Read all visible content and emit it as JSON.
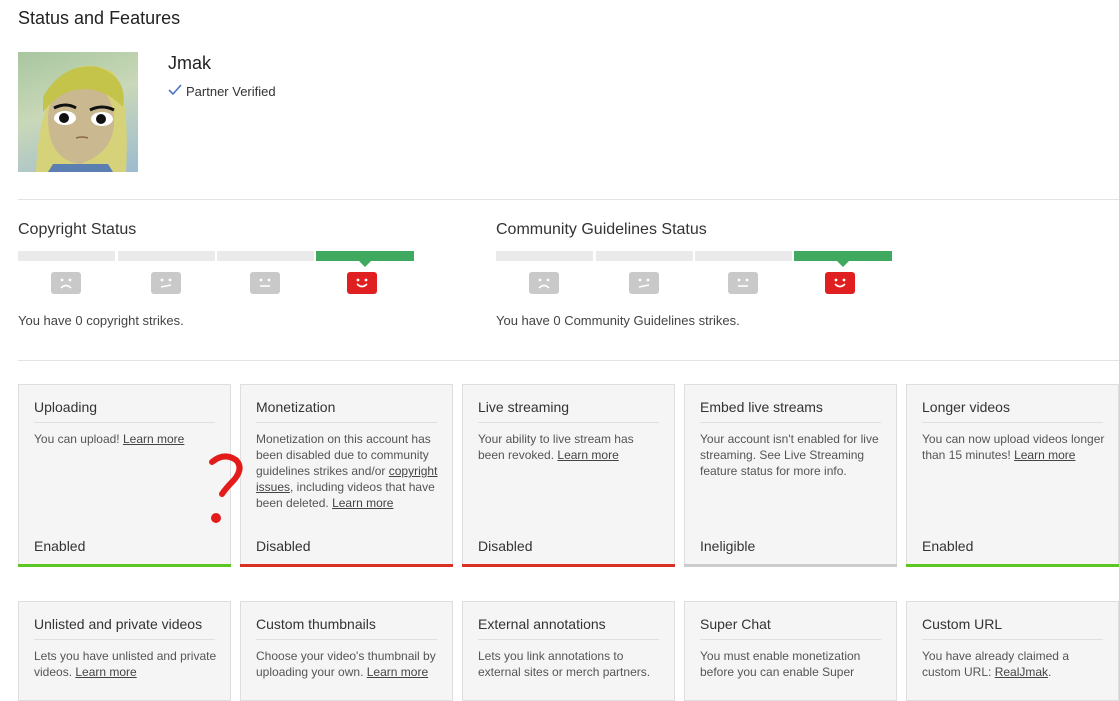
{
  "page": {
    "title": "Status and Features",
    "channel_name": "Jmak",
    "verified_label": "Partner Verified"
  },
  "copyright": {
    "title": "Copyright Status",
    "text": "You have 0 copyright strikes."
  },
  "community": {
    "title": "Community Guidelines Status",
    "text": "You have 0 Community Guidelines strikes."
  },
  "colors": {
    "enabled": "#5ac725",
    "disabled": "#d93025",
    "ineligible": "#cccccc",
    "meter_good": "#3fa95f",
    "face_active": "#e02020",
    "face_inactive": "#c9c9c9"
  },
  "features_row1": [
    {
      "title": "Uploading",
      "desc": "You can upload! ",
      "link": "Learn more",
      "status": "Enabled"
    },
    {
      "title": "Monetization",
      "desc_a": "Monetization on this account has been disabled due to community guidelines strikes and/or ",
      "link_a": "copyright issues",
      "desc_b": ", including videos that have been deleted. ",
      "link": "Learn more",
      "status": "Disabled"
    },
    {
      "title": "Live streaming",
      "desc": "Your ability to live stream has been revoked. ",
      "link": "Learn more",
      "status": "Disabled"
    },
    {
      "title": "Embed live streams",
      "desc": "Your account isn't enabled for live streaming. See Live Streaming feature status for more info.",
      "status": "Ineligible"
    },
    {
      "title": "Longer videos",
      "desc": "You can now upload videos longer than 15 minutes! ",
      "link": "Learn more",
      "status": "Enabled"
    }
  ],
  "features_row2": [
    {
      "title": "Unlisted and private videos",
      "desc": "Lets you have unlisted and private videos. ",
      "link": "Learn more"
    },
    {
      "title": "Custom thumbnails",
      "desc": "Choose your video's thumbnail by uploading your own. ",
      "link": "Learn more"
    },
    {
      "title": "External annotations",
      "desc": "Lets you link annotations to external sites or merch partners."
    },
    {
      "title": "Super Chat",
      "desc": "You must enable monetization before you can enable Super"
    },
    {
      "title": "Custom URL",
      "desc": "You have already claimed a custom URL: ",
      "link": "RealJmak",
      "tail": "."
    }
  ]
}
